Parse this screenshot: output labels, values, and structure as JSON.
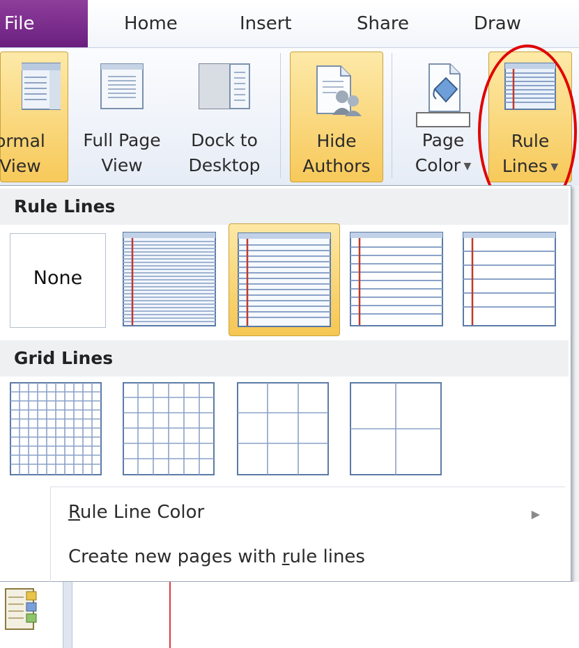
{
  "tabs": {
    "file": "File",
    "home": "Home",
    "insert": "Insert",
    "share": "Share",
    "draw": "Draw"
  },
  "ribbon": {
    "normal_view": [
      "ormal",
      "View"
    ],
    "full_page_view": [
      "Full Page",
      "View"
    ],
    "dock_to_desktop": [
      "Dock to",
      "Desktop"
    ],
    "hide_authors": [
      "Hide",
      "Authors"
    ],
    "page_color": [
      "Page",
      "Color"
    ],
    "rule_lines": [
      "Rule",
      "Lines"
    ]
  },
  "dropdown": {
    "rule_lines_header": "Rule Lines",
    "none_label": "None",
    "grid_lines_header": "Grid Lines",
    "rule_line_color": {
      "underlined": "R",
      "rest": "ule Line Color"
    },
    "create_new_pages": {
      "before": "Create new pages with ",
      "underlined": "r",
      "after": "ule lines"
    }
  },
  "colors": {
    "file_tab": "#7b2d8e",
    "highlight": "#f7c95a",
    "annotation_circle": "#e00000",
    "margin_line": "#c0392b",
    "rule_line": "#8aa2c8"
  }
}
